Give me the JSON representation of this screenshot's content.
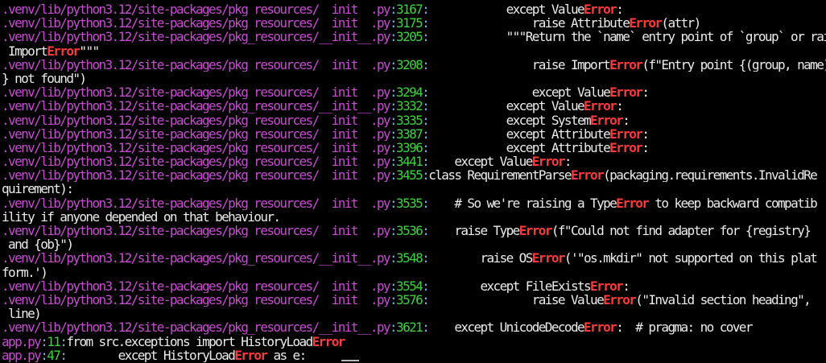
{
  "colors": {
    "background": "#000000",
    "path": "#c74ed0",
    "separator": "#6fb8d8",
    "line_number": "#3fd23f",
    "code": "#ececec",
    "match": "#ff3b3b"
  },
  "lines": [
    {
      "file": ".venv/lib/python3.12/site-packages/pkg_resources/__init__.py",
      "sep": ":",
      "num": "3167",
      "sep2": ":",
      "pre": "            except Value",
      "match": "Error",
      "post": ":"
    },
    {
      "file": ".venv/lib/python3.12/site-packages/pkg_resources/__init__.py",
      "sep": ":",
      "num": "3175",
      "sep2": ":",
      "pre": "                raise Attribute",
      "match": "Error",
      "post": "(attr)"
    },
    {
      "file": ".venv/lib/python3.12/site-packages/pkg_resources/__init__.py",
      "sep": ":",
      "num": "3205",
      "sep2": ":",
      "pre": "            \"\"\"Return the `name` entry point of `group` or raise",
      "match": "",
      "post": ""
    },
    {
      "file": "",
      "sep": "",
      "num": "",
      "sep2": "",
      "pre": " Import",
      "match": "Error",
      "post": "\"\"\""
    },
    {
      "file": ".venv/lib/python3.12/site-packages/pkg_resources/__init__.py",
      "sep": ":",
      "num": "3208",
      "sep2": ":",
      "pre": "                raise Import",
      "match": "Error",
      "post": "(f\"Entry point {(group, name)!r"
    },
    {
      "file": "",
      "sep": "",
      "num": "",
      "sep2": "",
      "pre": "} not found\")",
      "match": "",
      "post": ""
    },
    {
      "file": ".venv/lib/python3.12/site-packages/pkg_resources/__init__.py",
      "sep": ":",
      "num": "3294",
      "sep2": ":",
      "pre": "                except Value",
      "match": "Error",
      "post": ":"
    },
    {
      "file": ".venv/lib/python3.12/site-packages/pkg_resources/__init__.py",
      "sep": ":",
      "num": "3332",
      "sep2": ":",
      "pre": "            except Value",
      "match": "Error",
      "post": ":"
    },
    {
      "file": ".venv/lib/python3.12/site-packages/pkg_resources/__init__.py",
      "sep": ":",
      "num": "3335",
      "sep2": ":",
      "pre": "            except System",
      "match": "Error",
      "post": ":"
    },
    {
      "file": ".venv/lib/python3.12/site-packages/pkg_resources/__init__.py",
      "sep": ":",
      "num": "3387",
      "sep2": ":",
      "pre": "            except Attribute",
      "match": "Error",
      "post": ":"
    },
    {
      "file": ".venv/lib/python3.12/site-packages/pkg_resources/__init__.py",
      "sep": ":",
      "num": "3396",
      "sep2": ":",
      "pre": "            except Attribute",
      "match": "Error",
      "post": ":"
    },
    {
      "file": ".venv/lib/python3.12/site-packages/pkg_resources/__init__.py",
      "sep": ":",
      "num": "3441",
      "sep2": ":",
      "pre": "    except Value",
      "match": "Error",
      "post": ":"
    },
    {
      "file": ".venv/lib/python3.12/site-packages/pkg_resources/__init__.py",
      "sep": ":",
      "num": "3455",
      "sep2": ":",
      "pre": "class RequirementParse",
      "match": "Error",
      "post": "(packaging.requirements.InvalidRe"
    },
    {
      "file": "",
      "sep": "",
      "num": "",
      "sep2": "",
      "pre": "quirement):",
      "match": "",
      "post": ""
    },
    {
      "file": ".venv/lib/python3.12/site-packages/pkg_resources/__init__.py",
      "sep": ":",
      "num": "3535",
      "sep2": ":",
      "pre": "    # So we're raising a Type",
      "match": "Error",
      "post": " to keep backward compatib"
    },
    {
      "file": "",
      "sep": "",
      "num": "",
      "sep2": "",
      "pre": "ility if anyone depended on that behaviour.",
      "match": "",
      "post": ""
    },
    {
      "file": ".venv/lib/python3.12/site-packages/pkg_resources/__init__.py",
      "sep": ":",
      "num": "3536",
      "sep2": ":",
      "pre": "    raise Type",
      "match": "Error",
      "post": "(f\"Could not find adapter for {registry}"
    },
    {
      "file": "",
      "sep": "",
      "num": "",
      "sep2": "",
      "pre": " and {ob}\")",
      "match": "",
      "post": ""
    },
    {
      "file": ".venv/lib/python3.12/site-packages/pkg_resources/__init__.py",
      "sep": ":",
      "num": "3548",
      "sep2": ":",
      "pre": "        raise OS",
      "match": "Error",
      "post": "('\"os.mkdir\" not supported on this plat"
    },
    {
      "file": "",
      "sep": "",
      "num": "",
      "sep2": "",
      "pre": "form.')",
      "match": "",
      "post": ""
    },
    {
      "file": ".venv/lib/python3.12/site-packages/pkg_resources/__init__.py",
      "sep": ":",
      "num": "3554",
      "sep2": ":",
      "pre": "        except FileExists",
      "match": "Error",
      "post": ":"
    },
    {
      "file": ".venv/lib/python3.12/site-packages/pkg_resources/__init__.py",
      "sep": ":",
      "num": "3576",
      "sep2": ":",
      "pre": "                raise Value",
      "match": "Error",
      "post": "(\"Invalid section heading\","
    },
    {
      "file": "",
      "sep": "",
      "num": "",
      "sep2": "",
      "pre": " line)",
      "match": "",
      "post": ""
    },
    {
      "file": ".venv/lib/python3.12/site-packages/pkg_resources/__init__.py",
      "sep": ":",
      "num": "3621",
      "sep2": ":",
      "pre": "    except UnicodeDecode",
      "match": "Error",
      "post": ":  # pragma: no cover"
    },
    {
      "file": "app.py",
      "sep": ":",
      "num": "11",
      "sep2": ":",
      "pre": "from src.exceptions import HistoryLoad",
      "match": "Error",
      "post": ""
    },
    {
      "file": "app.py",
      "sep": ":",
      "num": "47",
      "sep2": ":",
      "pre": "        except HistoryLoad",
      "match": "Error",
      "post": " as e:"
    }
  ]
}
